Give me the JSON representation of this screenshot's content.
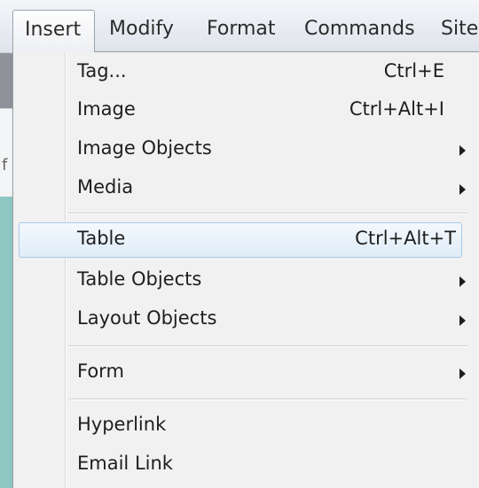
{
  "menubar": {
    "items": [
      {
        "label": "Insert"
      },
      {
        "label": "Modify"
      },
      {
        "label": "Format"
      },
      {
        "label": "Commands"
      },
      {
        "label": "Site"
      }
    ],
    "active": "Insert"
  },
  "dropdown": {
    "items": [
      {
        "label": "Tag...",
        "shortcut": "Ctrl+E"
      },
      {
        "label": "Image",
        "shortcut": "Ctrl+Alt+I"
      },
      {
        "label": "Image Objects",
        "submenu": true
      },
      {
        "label": "Media",
        "submenu": true
      },
      {
        "label": "Table",
        "shortcut": "Ctrl+Alt+T",
        "highlighted": true
      },
      {
        "label": "Table Objects",
        "submenu": true
      },
      {
        "label": "Layout Objects",
        "submenu": true
      },
      {
        "label": "Form",
        "submenu": true
      },
      {
        "label": "Hyperlink"
      },
      {
        "label": "Email Link"
      }
    ]
  },
  "background": {
    "fragment_glyph": "f"
  },
  "colors": {
    "highlight_fill": "#dfecf8",
    "highlight_border": "#a8c9ea",
    "menu_background": "#f1f1f1",
    "side_panel": "#8ec6c2"
  },
  "icons": {
    "submenu_arrow": "chevron-right-icon"
  }
}
